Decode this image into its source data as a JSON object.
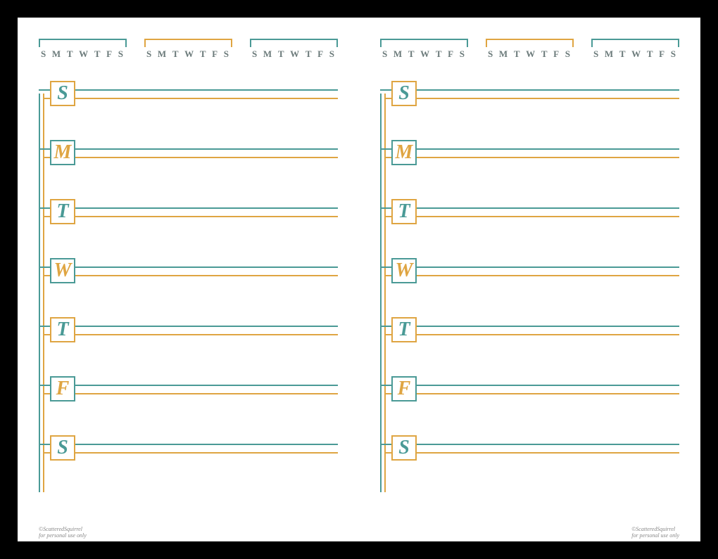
{
  "colors": {
    "teal": "#4a9a96",
    "amber": "#dfa542",
    "grey": "#6b7a7a"
  },
  "mini_cal_days": [
    "S",
    "M",
    "T",
    "W",
    "T",
    "F",
    "S"
  ],
  "mini_cal_colors": [
    "teal",
    "amber",
    "teal"
  ],
  "days": [
    {
      "letter": "S",
      "text_color": "teal",
      "box_color": "amber"
    },
    {
      "letter": "M",
      "text_color": "amber",
      "box_color": "teal"
    },
    {
      "letter": "T",
      "text_color": "teal",
      "box_color": "amber"
    },
    {
      "letter": "W",
      "text_color": "amber",
      "box_color": "teal"
    },
    {
      "letter": "T",
      "text_color": "teal",
      "box_color": "amber"
    },
    {
      "letter": "F",
      "text_color": "amber",
      "box_color": "teal"
    },
    {
      "letter": "S",
      "text_color": "teal",
      "box_color": "amber"
    }
  ],
  "credit_main": "©ScatteredSquirrel",
  "credit_sub": "for personal use only"
}
